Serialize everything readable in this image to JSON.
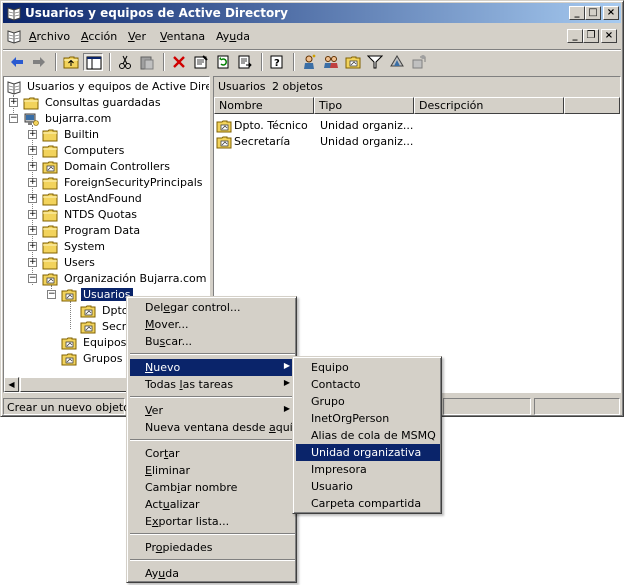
{
  "window": {
    "title": "Usuarios y equipos de Active Directory",
    "buttons": {
      "minimize": "_",
      "maximize": "□",
      "close": "×"
    }
  },
  "menubar": {
    "items": [
      {
        "pre": "",
        "key": "A",
        "post": "rchivo"
      },
      {
        "pre": "",
        "key": "A",
        "post": "cción"
      },
      {
        "pre": "",
        "key": "V",
        "post": "er"
      },
      {
        "pre": "",
        "key": "V",
        "post": "entana"
      },
      {
        "pre": "Ay",
        "key": "u",
        "post": "da"
      }
    ],
    "mdi": {
      "minimize": "_",
      "restore": "❐",
      "close": "×"
    }
  },
  "toolbar": {
    "icons": [
      "back-arrow-icon",
      "forward-arrow-icon",
      "up-folder-icon",
      "console-tree-icon",
      "cut-icon",
      "paste-icon",
      "delete-icon",
      "properties-icon",
      "refresh-icon",
      "export-icon",
      "help-icon",
      "new-user-icon",
      "new-group-icon",
      "new-ou-icon",
      "filter-icon",
      "find-icon",
      "add-to-group-icon"
    ]
  },
  "tree": {
    "root": "Usuarios y equipos de Active Directory",
    "saved_queries": "Consultas guardadas",
    "domain": "bujarra.com",
    "containers": [
      "Builtin",
      "Computers",
      "Domain Controllers",
      "ForeignSecurityPrincipals",
      "LostAndFound",
      "NTDS Quotas",
      "Program Data",
      "System",
      "Users"
    ],
    "org": "Organización Bujarra.com",
    "usuarios": "Usuarios",
    "usuarios_children": [
      "Dpto. Técnico",
      "Secretaría"
    ],
    "equipos": "Equipos",
    "grupos": "Grupos"
  },
  "right_pane": {
    "location": "Usuarios",
    "count": "2 objetos",
    "columns": [
      "Nombre",
      "Tipo",
      "Descripción"
    ],
    "rows": [
      {
        "name": "Dpto. Técnico",
        "type": "Unidad organiz...",
        "desc": ""
      },
      {
        "name": "Secretaría",
        "type": "Unidad organiz...",
        "desc": ""
      }
    ]
  },
  "statusbar": {
    "text": "Crear un nuevo objeto..."
  },
  "context_menu": {
    "delegar": {
      "pre": "Del",
      "key": "e",
      "post": "gar control..."
    },
    "mover": {
      "pre": "",
      "key": "M",
      "post": "over..."
    },
    "buscar": {
      "pre": "Bu",
      "key": "s",
      "post": "car..."
    },
    "nuevo": {
      "pre": "",
      "key": "N",
      "post": "uevo"
    },
    "todas": {
      "pre": "Todas ",
      "key": "l",
      "post": "as tareas"
    },
    "ver": {
      "pre": "",
      "key": "V",
      "post": "er"
    },
    "nueva_ventana": {
      "pre": "Nueva ventana desde ",
      "key": "a",
      "post": "quí"
    },
    "cortar": {
      "pre": "Cor",
      "key": "t",
      "post": "ar"
    },
    "eliminar": {
      "pre": "",
      "key": "E",
      "post": "liminar"
    },
    "cambiar": {
      "pre": "Camb",
      "key": "i",
      "post": "ar nombre"
    },
    "actualizar": {
      "pre": "Act",
      "key": "u",
      "post": "alizar"
    },
    "exportar": {
      "pre": "E",
      "key": "x",
      "post": "portar lista..."
    },
    "propiedades": {
      "pre": "Pr",
      "key": "o",
      "post": "piedades"
    },
    "ayuda": {
      "pre": "Ay",
      "key": "u",
      "post": "da"
    }
  },
  "submenu": {
    "items": [
      "Equipo",
      "Contacto",
      "Grupo",
      "InetOrgPerson",
      "Alias de cola de MSMQ",
      "Unidad organizativa",
      "Impresora",
      "Usuario",
      "Carpeta compartida"
    ],
    "highlighted": "Unidad organizativa"
  },
  "colors": {
    "titlebar_start": "#0a246a",
    "titlebar_end": "#a6caf0",
    "face": "#d4d0c8",
    "highlight": "#0a246a",
    "folder": "#f2d35c"
  }
}
